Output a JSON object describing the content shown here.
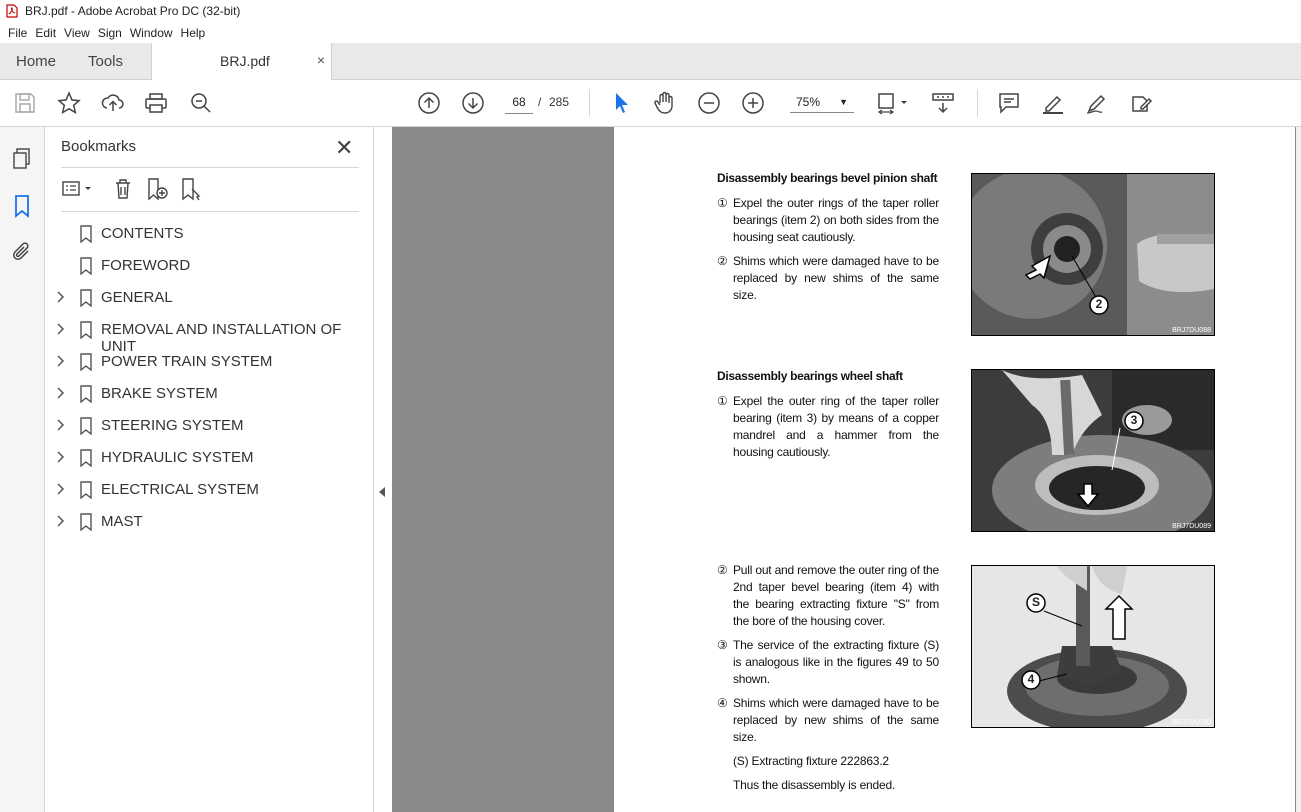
{
  "window": {
    "title": "BRJ.pdf - Adobe Acrobat Pro DC (32-bit)"
  },
  "menu": [
    "File",
    "Edit",
    "View",
    "Sign",
    "Window",
    "Help"
  ],
  "tabs": {
    "home": "Home",
    "tools": "Tools",
    "document": "BRJ.pdf",
    "close": "×"
  },
  "toolbar": {
    "page_current": "68",
    "page_separator": "/",
    "page_total": "285",
    "zoom": "75%",
    "icons": [
      "save-icon",
      "bookmark-star-icon",
      "upload-icon",
      "print-icon",
      "search-zoom-icon",
      "page-up-icon",
      "page-down-icon",
      "select-arrow-icon",
      "hand-icon",
      "zoom-out-icon",
      "zoom-in-icon",
      "fit-page-icon",
      "scroll-mode-icon",
      "comment-icon",
      "highlight-pen-icon",
      "sign-icon",
      "edit-pdf-icon"
    ]
  },
  "bookmarks": {
    "title": "Bookmarks",
    "close": "✕",
    "items": [
      {
        "label": "CONTENTS",
        "expandable": false
      },
      {
        "label": "FOREWORD",
        "expandable": false
      },
      {
        "label": "GENERAL",
        "expandable": true
      },
      {
        "label": "REMOVAL AND INSTALLATION OF UNIT",
        "expandable": true
      },
      {
        "label": "POWER TRAIN SYSTEM",
        "expandable": true
      },
      {
        "label": "BRAKE SYSTEM",
        "expandable": true
      },
      {
        "label": "STEERING SYSTEM",
        "expandable": true
      },
      {
        "label": "HYDRAULIC SYSTEM",
        "expandable": true
      },
      {
        "label": "ELECTRICAL SYSTEM",
        "expandable": true
      },
      {
        "label": "MAST",
        "expandable": true
      }
    ]
  },
  "page": {
    "section1": {
      "heading": "Disassembly bearings bevel pinion shaft",
      "steps": [
        {
          "num": "①",
          "text": "Expel the outer rings of the taper roller bearings (item 2) on both sides from the housing seat cautiously."
        },
        {
          "num": "②",
          "text": "Shims which were damaged have to be replaced by new shims of the same size."
        }
      ],
      "image_code": "BRJ7DU088",
      "callout": "2"
    },
    "section2": {
      "heading": "Disassembly bearings wheel shaft",
      "steps": [
        {
          "num": "①",
          "text": "Expel the outer ring of the taper roller bearing (item 3) by means of a copper mandrel and a hammer from the housing cautiously."
        }
      ],
      "image_code": "BRJ7DU089",
      "callout": "3"
    },
    "section3": {
      "steps": [
        {
          "num": "②",
          "text": "Pull out and remove the outer ring of the 2nd taper bevel bearing (item 4) with the bearing extracting fixture \"S\" from the bore of the housing cover."
        },
        {
          "num": "③",
          "text": "The service of the extracting fixture (S) is analogous like in the figures 49 to 50 shown."
        },
        {
          "num": "④",
          "text": "Shims which were damaged have to be replaced by new shims of the same size."
        }
      ],
      "note1": "(S) Extracting fixture 222863.2",
      "note2": "Thus the disassembly is ended.",
      "image_code": "BRJ7DU090",
      "callout_s": "S",
      "callout_4": "4"
    }
  }
}
